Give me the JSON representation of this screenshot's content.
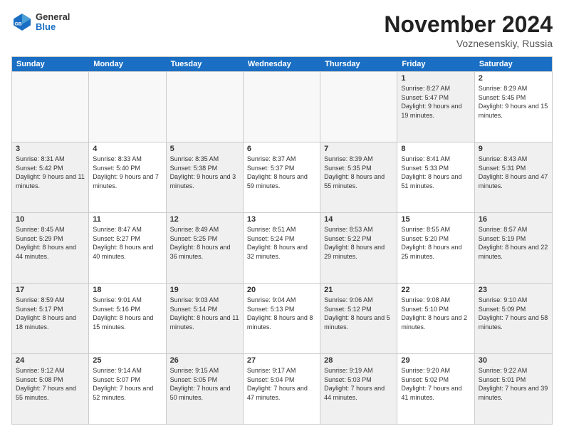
{
  "logo": {
    "general": "General",
    "blue": "Blue"
  },
  "title": "November 2024",
  "location": "Voznesenskiy, Russia",
  "days_of_week": [
    "Sunday",
    "Monday",
    "Tuesday",
    "Wednesday",
    "Thursday",
    "Friday",
    "Saturday"
  ],
  "weeks": [
    [
      {
        "day": "",
        "info": "",
        "empty": true
      },
      {
        "day": "",
        "info": "",
        "empty": true
      },
      {
        "day": "",
        "info": "",
        "empty": true
      },
      {
        "day": "",
        "info": "",
        "empty": true
      },
      {
        "day": "",
        "info": "",
        "empty": true
      },
      {
        "day": "1",
        "info": "Sunrise: 8:27 AM\nSunset: 5:47 PM\nDaylight: 9 hours and 19 minutes.",
        "empty": false,
        "shaded": true
      },
      {
        "day": "2",
        "info": "Sunrise: 8:29 AM\nSunset: 5:45 PM\nDaylight: 9 hours and 15 minutes.",
        "empty": false
      }
    ],
    [
      {
        "day": "3",
        "info": "Sunrise: 8:31 AM\nSunset: 5:42 PM\nDaylight: 9 hours and 11 minutes.",
        "empty": false,
        "shaded": true
      },
      {
        "day": "4",
        "info": "Sunrise: 8:33 AM\nSunset: 5:40 PM\nDaylight: 9 hours and 7 minutes.",
        "empty": false
      },
      {
        "day": "5",
        "info": "Sunrise: 8:35 AM\nSunset: 5:38 PM\nDaylight: 9 hours and 3 minutes.",
        "empty": false,
        "shaded": true
      },
      {
        "day": "6",
        "info": "Sunrise: 8:37 AM\nSunset: 5:37 PM\nDaylight: 8 hours and 59 minutes.",
        "empty": false
      },
      {
        "day": "7",
        "info": "Sunrise: 8:39 AM\nSunset: 5:35 PM\nDaylight: 8 hours and 55 minutes.",
        "empty": false,
        "shaded": true
      },
      {
        "day": "8",
        "info": "Sunrise: 8:41 AM\nSunset: 5:33 PM\nDaylight: 8 hours and 51 minutes.",
        "empty": false
      },
      {
        "day": "9",
        "info": "Sunrise: 8:43 AM\nSunset: 5:31 PM\nDaylight: 8 hours and 47 minutes.",
        "empty": false,
        "shaded": true
      }
    ],
    [
      {
        "day": "10",
        "info": "Sunrise: 8:45 AM\nSunset: 5:29 PM\nDaylight: 8 hours and 44 minutes.",
        "empty": false,
        "shaded": true
      },
      {
        "day": "11",
        "info": "Sunrise: 8:47 AM\nSunset: 5:27 PM\nDaylight: 8 hours and 40 minutes.",
        "empty": false
      },
      {
        "day": "12",
        "info": "Sunrise: 8:49 AM\nSunset: 5:25 PM\nDaylight: 8 hours and 36 minutes.",
        "empty": false,
        "shaded": true
      },
      {
        "day": "13",
        "info": "Sunrise: 8:51 AM\nSunset: 5:24 PM\nDaylight: 8 hours and 32 minutes.",
        "empty": false
      },
      {
        "day": "14",
        "info": "Sunrise: 8:53 AM\nSunset: 5:22 PM\nDaylight: 8 hours and 29 minutes.",
        "empty": false,
        "shaded": true
      },
      {
        "day": "15",
        "info": "Sunrise: 8:55 AM\nSunset: 5:20 PM\nDaylight: 8 hours and 25 minutes.",
        "empty": false
      },
      {
        "day": "16",
        "info": "Sunrise: 8:57 AM\nSunset: 5:19 PM\nDaylight: 8 hours and 22 minutes.",
        "empty": false,
        "shaded": true
      }
    ],
    [
      {
        "day": "17",
        "info": "Sunrise: 8:59 AM\nSunset: 5:17 PM\nDaylight: 8 hours and 18 minutes.",
        "empty": false,
        "shaded": true
      },
      {
        "day": "18",
        "info": "Sunrise: 9:01 AM\nSunset: 5:16 PM\nDaylight: 8 hours and 15 minutes.",
        "empty": false
      },
      {
        "day": "19",
        "info": "Sunrise: 9:03 AM\nSunset: 5:14 PM\nDaylight: 8 hours and 11 minutes.",
        "empty": false,
        "shaded": true
      },
      {
        "day": "20",
        "info": "Sunrise: 9:04 AM\nSunset: 5:13 PM\nDaylight: 8 hours and 8 minutes.",
        "empty": false
      },
      {
        "day": "21",
        "info": "Sunrise: 9:06 AM\nSunset: 5:12 PM\nDaylight: 8 hours and 5 minutes.",
        "empty": false,
        "shaded": true
      },
      {
        "day": "22",
        "info": "Sunrise: 9:08 AM\nSunset: 5:10 PM\nDaylight: 8 hours and 2 minutes.",
        "empty": false
      },
      {
        "day": "23",
        "info": "Sunrise: 9:10 AM\nSunset: 5:09 PM\nDaylight: 7 hours and 58 minutes.",
        "empty": false,
        "shaded": true
      }
    ],
    [
      {
        "day": "24",
        "info": "Sunrise: 9:12 AM\nSunset: 5:08 PM\nDaylight: 7 hours and 55 minutes.",
        "empty": false,
        "shaded": true
      },
      {
        "day": "25",
        "info": "Sunrise: 9:14 AM\nSunset: 5:07 PM\nDaylight: 7 hours and 52 minutes.",
        "empty": false
      },
      {
        "day": "26",
        "info": "Sunrise: 9:15 AM\nSunset: 5:05 PM\nDaylight: 7 hours and 50 minutes.",
        "empty": false,
        "shaded": true
      },
      {
        "day": "27",
        "info": "Sunrise: 9:17 AM\nSunset: 5:04 PM\nDaylight: 7 hours and 47 minutes.",
        "empty": false
      },
      {
        "day": "28",
        "info": "Sunrise: 9:19 AM\nSunset: 5:03 PM\nDaylight: 7 hours and 44 minutes.",
        "empty": false,
        "shaded": true
      },
      {
        "day": "29",
        "info": "Sunrise: 9:20 AM\nSunset: 5:02 PM\nDaylight: 7 hours and 41 minutes.",
        "empty": false
      },
      {
        "day": "30",
        "info": "Sunrise: 9:22 AM\nSunset: 5:01 PM\nDaylight: 7 hours and 39 minutes.",
        "empty": false,
        "shaded": true
      }
    ]
  ]
}
